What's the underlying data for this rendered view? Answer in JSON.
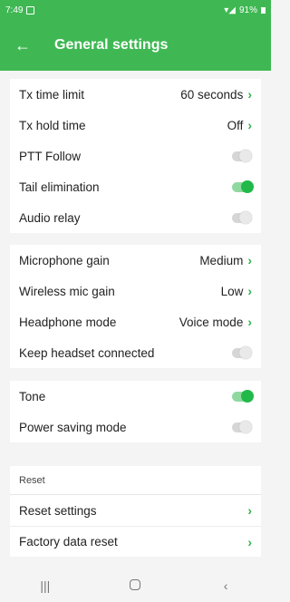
{
  "status": {
    "time": "7:49",
    "battery": "91%"
  },
  "header": {
    "title": "General settings"
  },
  "group1": [
    {
      "label": "Tx time limit",
      "value": "60 seconds",
      "type": "value"
    },
    {
      "label": "Tx hold time",
      "value": "Off",
      "type": "value"
    },
    {
      "label": "PTT Follow",
      "type": "toggle",
      "on": false
    },
    {
      "label": "Tail elimination",
      "type": "toggle",
      "on": true
    },
    {
      "label": "Audio relay",
      "type": "toggle",
      "on": false
    }
  ],
  "group2": [
    {
      "label": "Microphone gain",
      "value": "Medium",
      "type": "value"
    },
    {
      "label": "Wireless mic gain",
      "value": "Low",
      "type": "value"
    },
    {
      "label": "Headphone mode",
      "value": "Voice mode",
      "type": "value"
    },
    {
      "label": "Keep headset connected",
      "type": "toggle",
      "on": false
    }
  ],
  "group3": [
    {
      "label": "Tone",
      "type": "toggle",
      "on": true
    },
    {
      "label": "Power saving mode",
      "type": "toggle",
      "on": false
    }
  ],
  "reset": {
    "header": "Reset",
    "items": [
      {
        "label": "Reset settings"
      },
      {
        "label": "Factory data reset"
      }
    ]
  },
  "colors": {
    "accent": "#3fb853",
    "toggle_on": "#21b94a"
  }
}
